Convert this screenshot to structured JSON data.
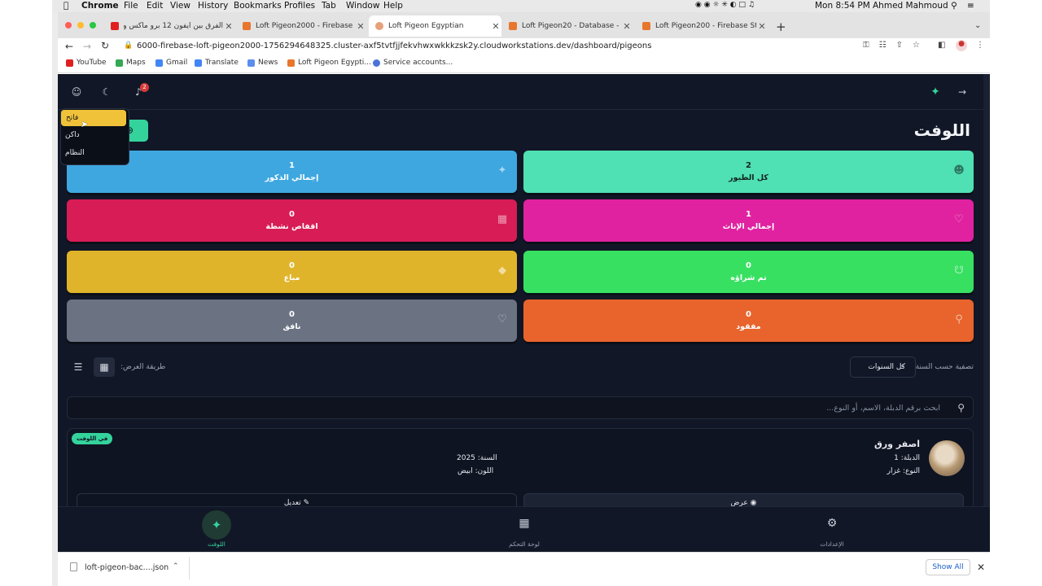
{
  "menubar": {
    "app": "Chrome",
    "items": [
      "File",
      "Edit",
      "View",
      "History",
      "Bookmarks",
      "Profiles",
      "Tab",
      "Window",
      "Help"
    ],
    "clock": "Mon 8:54 PM",
    "user": "Ahmed Mahmoud"
  },
  "tabs": [
    {
      "title": "الفرق بين ايفون 12 برو ماكس وايفون ١١",
      "color": "#e02020"
    },
    {
      "title": "Loft Pigeon2000 - Firebase Stu",
      "color": "#e8762d"
    },
    {
      "title": "Loft Pigeon Egyptian",
      "color": "#e8a07a"
    },
    {
      "title": "Loft Pigeon20 - Database - Da",
      "color": "#e8762d"
    },
    {
      "title": "Loft Pigeon200 - Firebase Stu",
      "color": "#e8762d"
    }
  ],
  "url": "6000-firebase-loft-pigeon2000-1756294648325.cluster-axf5tvtfjjfekvhwxwkkkzsk2y.cloudworkstations.dev/dashboard/pigeons",
  "bookmarks": [
    "YouTube",
    "Maps",
    "Gmail",
    "Translate",
    "News",
    "Loft Pigeon Egypti...",
    "Service accounts..."
  ],
  "header": {
    "notif_count": "2"
  },
  "theme_menu": {
    "light": "فاتح",
    "dark": "داكن",
    "system": "النظام"
  },
  "page": {
    "title": "اللوفت"
  },
  "stats": [
    {
      "value": "2",
      "label": "كل الطيور",
      "color": "#4fe0b4",
      "icon": "users-icon"
    },
    {
      "value": "1",
      "label": "إجمالي الذكور",
      "color": "#3ea7e0",
      "icon": "bird-icon"
    },
    {
      "value": "1",
      "label": "إجمالي الإناث",
      "color": "#e022a0",
      "icon": "heart-box-icon"
    },
    {
      "value": "0",
      "label": "اقفاص نشطة",
      "color": "#d81c55",
      "icon": "grid-icon"
    },
    {
      "value": "0",
      "label": "تم شراؤه",
      "color": "#38e062",
      "icon": "cart-icon"
    },
    {
      "value": "0",
      "label": "مباع",
      "color": "#e0b42a",
      "icon": "tag-icon"
    },
    {
      "value": "0",
      "label": "مفقود",
      "color": "#e8642c",
      "icon": "search-icon"
    },
    {
      "value": "0",
      "label": "نافق",
      "color": "#6b7383",
      "icon": "heart-icon"
    }
  ],
  "filters": {
    "year_label": "تصفية حسب السنة:",
    "year_value": "كل السنوات",
    "view_label": "طريقة العرض:"
  },
  "search": {
    "placeholder": "ابحث برقم الدبلة، الاسم، أو النوع..."
  },
  "pigeon": {
    "badge": "في اللوفت",
    "name": "اصفر ورق",
    "ring": "الدبلة: 1",
    "type": "النوع: غزار",
    "year": "السنة: 2025",
    "color": "اللون: ابيض",
    "view_label": "عرض",
    "edit_label": "تعديل"
  },
  "bottomnav": {
    "loft": "اللوفت",
    "dashboard": "لوحة التحكم",
    "settings": "الإعدادات"
  },
  "download": {
    "file": "loft-pigeon-bac....json",
    "show_all": "Show All"
  }
}
